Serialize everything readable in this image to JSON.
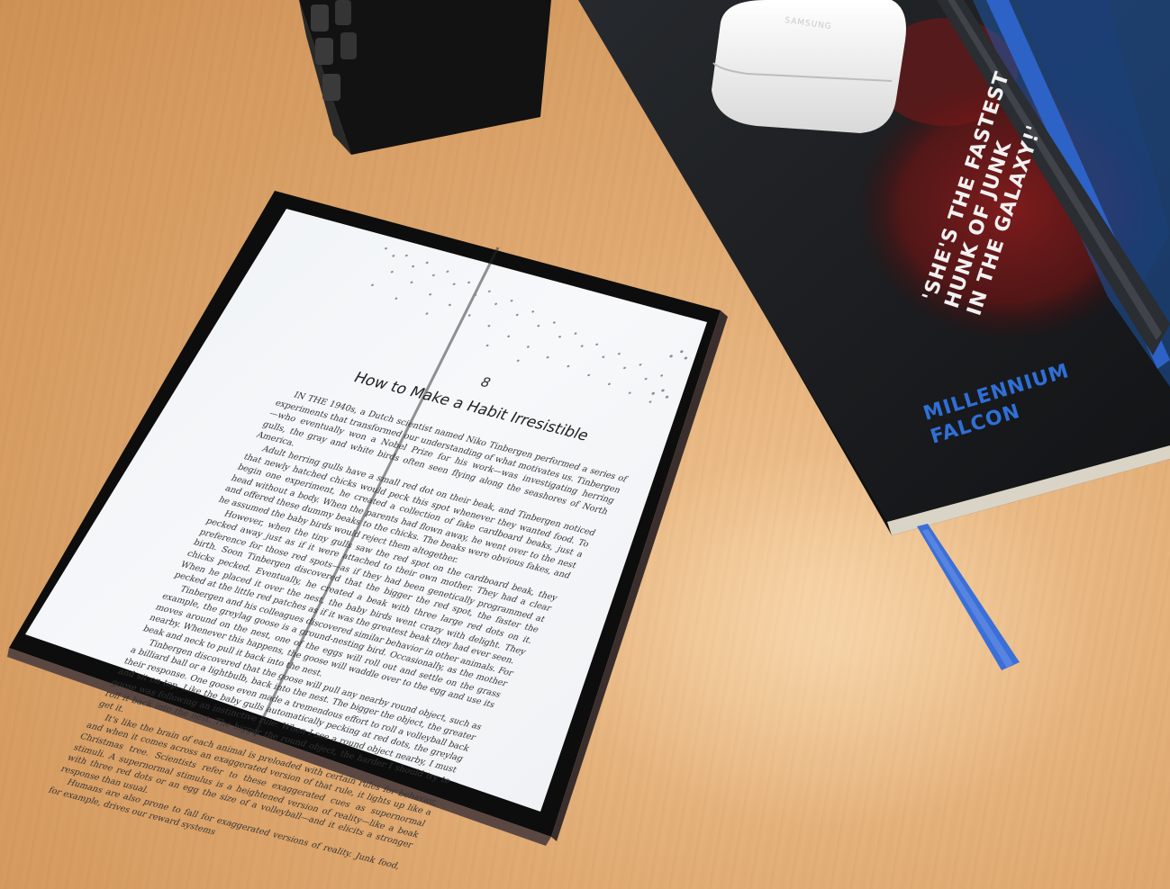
{
  "scene": {
    "description_free": true
  },
  "tablet": {
    "chapter_number": "8",
    "chapter_title": "How to Make a Habit Irresistible",
    "paragraphs": [
      "IN THE 1940s, a Dutch scientist named Niko Tinbergen performed a series of experiments that transformed our understanding of what motivates us. Tinbergen—who eventually won a Nobel Prize for his work—was investigating herring gulls, the gray and white birds often seen flying along the seashores of North America.",
      "Adult herring gulls have a small red dot on their beak, and Tinbergen noticed that newly hatched chicks would peck this spot whenever they wanted food. To begin one experiment, he created a collection of fake cardboard beaks, just a head without a body. When the parents had flown away, he went over to the nest and offered these dummy beaks to the chicks. The beaks were obvious fakes, and he assumed the baby birds would reject them altogether.",
      "However, when the tiny gulls saw the red spot on the cardboard beak, they pecked away just as if it were attached to their own mother. They had a clear preference for those red spots—as if they had been genetically programmed at birth. Soon Tinbergen discovered that the bigger the red spot, the faster the chicks pecked. Eventually, he created a beak with three large red dots on it. When he placed it over the nest, the baby birds went crazy with delight. They pecked at the little red patches as if it was the greatest beak they had ever seen.",
      "Tinbergen and his colleagues discovered similar behavior in other animals. For example, the greylag goose is a ground-nesting bird. Occasionally, as the mother moves around on the nest, one of the eggs will roll out and settle on the grass nearby. Whenever this happens, the goose will waddle over to the egg and use its beak and neck to pull it back into the nest.",
      "Tinbergen discovered that the goose will pull any nearby round object, such as a billiard ball or a lightbulb, back into the nest. The bigger the object, the greater their response. One goose even made a tremendous effort to roll a volleyball back and sit on top. Like the baby gulls automatically pecking at red dots, the greylag goose was following an instinctive rule: When I see a round object nearby, I must roll it back into the nest. The bigger the round object, the harder I should try to get it.",
      "It's like the brain of each animal is preloaded with certain rules for behavior, and when it comes across an exaggerated version of that rule, it lights up like a Christmas tree. Scientists refer to these exaggerated cues as supernormal stimuli. A supernormal stimulus is a heightened version of reality—like a beak with three red dots or an egg the size of a volleyball—and it elicits a stronger response than usual.",
      "Humans are also prone to fall for exaggerated versions of reality. Junk food, for example, drives our reward systems"
    ]
  },
  "notebook": {
    "quote": "'SHE'S THE FASTEST\nHUNK OF JUNK\nIN THE GALAXY!'",
    "title": "MILLENNIUM\nFALCON"
  },
  "earbuds_case": {
    "brand": "SAMSUNG"
  },
  "colors": {
    "table": "#e0aa72",
    "screen": "#f4f6f8",
    "bezel": "#141414",
    "notebook": "#1b1d20",
    "notebook_accent": "#2f6fd6",
    "bookmark": "#3b6fd8"
  }
}
